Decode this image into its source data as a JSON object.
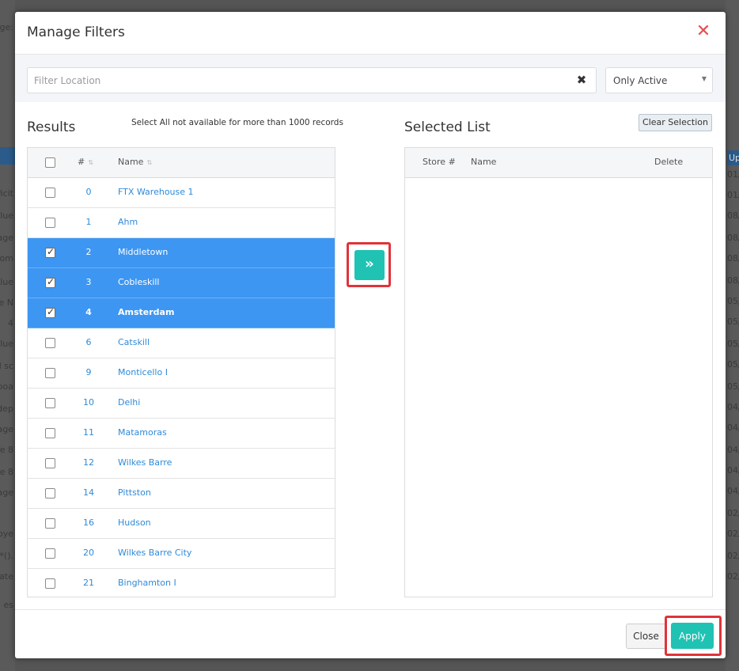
{
  "modal": {
    "title": "Manage Filters",
    "close_icon": "close-icon",
    "close_glyph": "✕"
  },
  "filter": {
    "placeholder": "Filter Location",
    "value": "",
    "clear_glyph": "✖",
    "status_value": "Only Active",
    "status_caret": "▼"
  },
  "results": {
    "title": "Results",
    "note": "Select All not available for more than 1000 records",
    "col_number": "#",
    "col_name": "Name",
    "sort_glyph": "⇅",
    "rows": [
      {
        "number": "0",
        "name": "FTX Warehouse 1",
        "checked": false
      },
      {
        "number": "1",
        "name": "Ahm",
        "checked": false
      },
      {
        "number": "2",
        "name": "Middletown",
        "checked": true
      },
      {
        "number": "3",
        "name": "Cobleskill",
        "checked": true
      },
      {
        "number": "4",
        "name": "Amsterdam",
        "checked": true
      },
      {
        "number": "6",
        "name": "Catskill",
        "checked": false
      },
      {
        "number": "9",
        "name": "Monticello I",
        "checked": false
      },
      {
        "number": "10",
        "name": "Delhi",
        "checked": false
      },
      {
        "number": "11",
        "name": "Matamoras",
        "checked": false
      },
      {
        "number": "12",
        "name": "Wilkes Barre",
        "checked": false
      },
      {
        "number": "14",
        "name": "Pittston",
        "checked": false
      },
      {
        "number": "16",
        "name": "Hudson",
        "checked": false
      },
      {
        "number": "20",
        "name": "Wilkes Barre City",
        "checked": false
      },
      {
        "number": "21",
        "name": "Binghamton I",
        "checked": false
      }
    ]
  },
  "move_button": {
    "glyph": "»",
    "icon": "double-chevron-right-icon"
  },
  "selected_list": {
    "title": "Selected List",
    "clear_label": "Clear Selection",
    "col_store": "Store #",
    "col_name": "Name",
    "col_delete": "Delete"
  },
  "footer": {
    "close_label": "Close",
    "apply_label": "Apply"
  },
  "background": {
    "left_fragments": [
      "ge:",
      "ficit",
      "lue",
      "age",
      "rom",
      "lue",
      "ile N",
      "4",
      "lue",
      "d sc",
      "boa",
      "dep",
      "age",
      "ce 8",
      "ce 8",
      "age",
      "loye",
      "*().",
      "l rate",
      "es"
    ],
    "right_fragments": [
      "Up",
      "01/",
      "01/",
      "08/",
      "08/",
      "08/",
      "08/",
      "05/",
      "05/",
      "05/",
      "05/",
      "05/",
      "04/",
      "04/",
      "04/",
      "04/",
      "04/",
      "02/",
      "02/",
      "02/",
      "02/"
    ]
  },
  "colors": {
    "accent": "#20c2b3",
    "selected_row": "#3d96f2",
    "link": "#2e8ad8",
    "highlight_frame": "#e0333a",
    "close_icon": "#e35050"
  }
}
